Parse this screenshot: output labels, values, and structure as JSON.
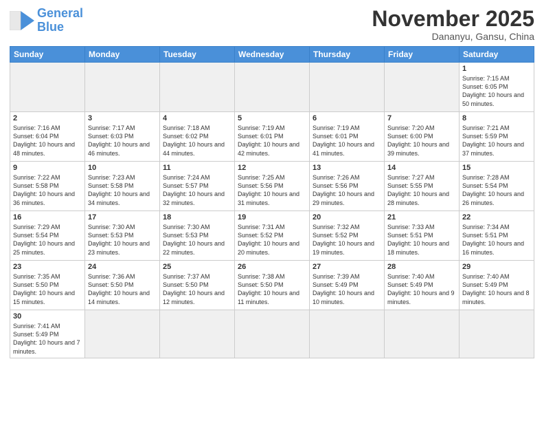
{
  "header": {
    "logo_general": "General",
    "logo_blue": "Blue",
    "month_title": "November 2025",
    "location": "Dananyu, Gansu, China"
  },
  "weekdays": [
    "Sunday",
    "Monday",
    "Tuesday",
    "Wednesday",
    "Thursday",
    "Friday",
    "Saturday"
  ],
  "days": [
    {
      "date": "",
      "info": ""
    },
    {
      "date": "",
      "info": ""
    },
    {
      "date": "",
      "info": ""
    },
    {
      "date": "",
      "info": ""
    },
    {
      "date": "",
      "info": ""
    },
    {
      "date": "",
      "info": ""
    },
    {
      "date": "1",
      "info": "Sunrise: 7:15 AM\nSunset: 6:05 PM\nDaylight: 10 hours\nand 50 minutes."
    },
    {
      "date": "2",
      "info": "Sunrise: 7:16 AM\nSunset: 6:04 PM\nDaylight: 10 hours\nand 48 minutes."
    },
    {
      "date": "3",
      "info": "Sunrise: 7:17 AM\nSunset: 6:03 PM\nDaylight: 10 hours\nand 46 minutes."
    },
    {
      "date": "4",
      "info": "Sunrise: 7:18 AM\nSunset: 6:02 PM\nDaylight: 10 hours\nand 44 minutes."
    },
    {
      "date": "5",
      "info": "Sunrise: 7:19 AM\nSunset: 6:01 PM\nDaylight: 10 hours\nand 42 minutes."
    },
    {
      "date": "6",
      "info": "Sunrise: 7:19 AM\nSunset: 6:01 PM\nDaylight: 10 hours\nand 41 minutes."
    },
    {
      "date": "7",
      "info": "Sunrise: 7:20 AM\nSunset: 6:00 PM\nDaylight: 10 hours\nand 39 minutes."
    },
    {
      "date": "8",
      "info": "Sunrise: 7:21 AM\nSunset: 5:59 PM\nDaylight: 10 hours\nand 37 minutes."
    },
    {
      "date": "9",
      "info": "Sunrise: 7:22 AM\nSunset: 5:58 PM\nDaylight: 10 hours\nand 36 minutes."
    },
    {
      "date": "10",
      "info": "Sunrise: 7:23 AM\nSunset: 5:58 PM\nDaylight: 10 hours\nand 34 minutes."
    },
    {
      "date": "11",
      "info": "Sunrise: 7:24 AM\nSunset: 5:57 PM\nDaylight: 10 hours\nand 32 minutes."
    },
    {
      "date": "12",
      "info": "Sunrise: 7:25 AM\nSunset: 5:56 PM\nDaylight: 10 hours\nand 31 minutes."
    },
    {
      "date": "13",
      "info": "Sunrise: 7:26 AM\nSunset: 5:56 PM\nDaylight: 10 hours\nand 29 minutes."
    },
    {
      "date": "14",
      "info": "Sunrise: 7:27 AM\nSunset: 5:55 PM\nDaylight: 10 hours\nand 28 minutes."
    },
    {
      "date": "15",
      "info": "Sunrise: 7:28 AM\nSunset: 5:54 PM\nDaylight: 10 hours\nand 26 minutes."
    },
    {
      "date": "16",
      "info": "Sunrise: 7:29 AM\nSunset: 5:54 PM\nDaylight: 10 hours\nand 25 minutes."
    },
    {
      "date": "17",
      "info": "Sunrise: 7:30 AM\nSunset: 5:53 PM\nDaylight: 10 hours\nand 23 minutes."
    },
    {
      "date": "18",
      "info": "Sunrise: 7:30 AM\nSunset: 5:53 PM\nDaylight: 10 hours\nand 22 minutes."
    },
    {
      "date": "19",
      "info": "Sunrise: 7:31 AM\nSunset: 5:52 PM\nDaylight: 10 hours\nand 20 minutes."
    },
    {
      "date": "20",
      "info": "Sunrise: 7:32 AM\nSunset: 5:52 PM\nDaylight: 10 hours\nand 19 minutes."
    },
    {
      "date": "21",
      "info": "Sunrise: 7:33 AM\nSunset: 5:51 PM\nDaylight: 10 hours\nand 18 minutes."
    },
    {
      "date": "22",
      "info": "Sunrise: 7:34 AM\nSunset: 5:51 PM\nDaylight: 10 hours\nand 16 minutes."
    },
    {
      "date": "23",
      "info": "Sunrise: 7:35 AM\nSunset: 5:50 PM\nDaylight: 10 hours\nand 15 minutes."
    },
    {
      "date": "24",
      "info": "Sunrise: 7:36 AM\nSunset: 5:50 PM\nDaylight: 10 hours\nand 14 minutes."
    },
    {
      "date": "25",
      "info": "Sunrise: 7:37 AM\nSunset: 5:50 PM\nDaylight: 10 hours\nand 12 minutes."
    },
    {
      "date": "26",
      "info": "Sunrise: 7:38 AM\nSunset: 5:50 PM\nDaylight: 10 hours\nand 11 minutes."
    },
    {
      "date": "27",
      "info": "Sunrise: 7:39 AM\nSunset: 5:49 PM\nDaylight: 10 hours\nand 10 minutes."
    },
    {
      "date": "28",
      "info": "Sunrise: 7:40 AM\nSunset: 5:49 PM\nDaylight: 10 hours\nand 9 minutes."
    },
    {
      "date": "29",
      "info": "Sunrise: 7:40 AM\nSunset: 5:49 PM\nDaylight: 10 hours\nand 8 minutes."
    },
    {
      "date": "30",
      "info": "Sunrise: 7:41 AM\nSunset: 5:49 PM\nDaylight: 10 hours\nand 7 minutes."
    },
    {
      "date": "",
      "info": ""
    },
    {
      "date": "",
      "info": ""
    },
    {
      "date": "",
      "info": ""
    },
    {
      "date": "",
      "info": ""
    },
    {
      "date": "",
      "info": ""
    },
    {
      "date": "",
      "info": ""
    }
  ]
}
